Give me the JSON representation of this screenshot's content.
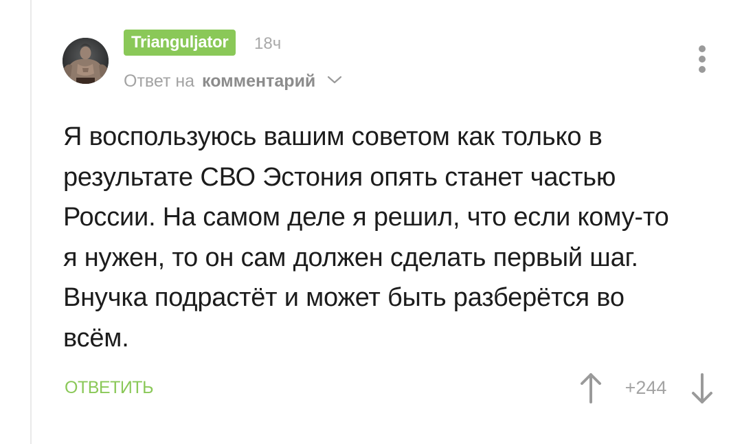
{
  "comment": {
    "author": "Trianguljator",
    "time": "18ч",
    "reply_prefix": "Ответ на",
    "reply_link": "комментарий",
    "lines": [
      "Я воспользуюсь вашим советом как только в",
      "результате СВО Эстония опять станет частью",
      "России. На самом деле я решил, что если кому-то",
      "я нужен, то он сам должен сделать первый шаг.",
      "Внучка подрастёт и может быть разберётся во",
      "всём."
    ],
    "reply_button": "ОТВЕТИТЬ",
    "rating": "+244"
  },
  "icons": {
    "avatar": "avatar-image",
    "reply_chevron": "chevron-down-icon",
    "menu": "more-vertical-icon",
    "upvote": "arrow-up-icon",
    "downvote": "arrow-down-icon"
  },
  "colors": {
    "accent_green": "#8ac858",
    "muted_text": "#a3a3a3",
    "body_text": "#1c1c1c",
    "thread_line": "#e9e9e9"
  }
}
